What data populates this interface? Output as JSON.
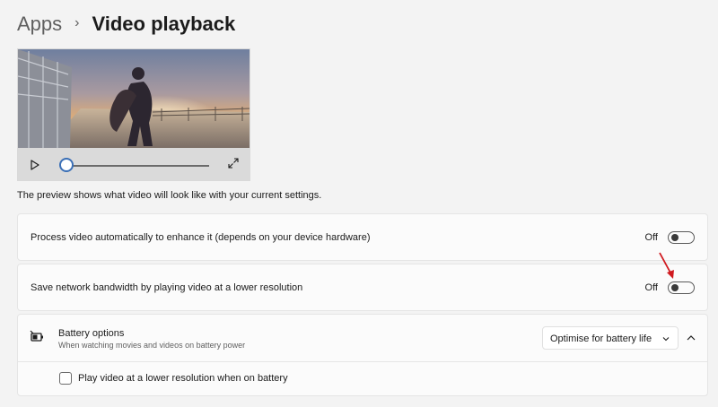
{
  "breadcrumb": {
    "parent": "Apps",
    "separator": "›",
    "current": "Video playback"
  },
  "preview": {
    "caption": "The preview shows what video will look like with your current settings.",
    "controls": {
      "play_icon": "play-icon",
      "expand_icon": "expand-icon",
      "seek_position": 0
    }
  },
  "settings": {
    "enhance": {
      "label": "Process video automatically to enhance it (depends on your device hardware)",
      "state": "Off",
      "on": false
    },
    "bandwidth": {
      "label": "Save network bandwidth by playing video at a lower resolution",
      "state": "Off",
      "on": false
    },
    "battery": {
      "title": "Battery options",
      "subtitle": "When watching movies and videos on battery power",
      "selected_option": "Optimise for battery life",
      "expanded": true,
      "checkbox_label": "Play video at a lower resolution when on battery",
      "checkbox_checked": false
    }
  },
  "colors": {
    "background": "#f3f3f3",
    "card": "#fbfbfb",
    "accent": "#3a6fb6",
    "annotation": "#d0191f"
  }
}
